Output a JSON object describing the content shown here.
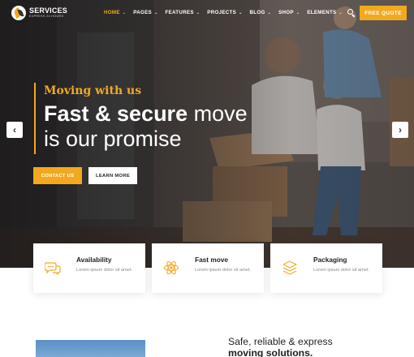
{
  "brand": {
    "name": "SERVICES",
    "tagline": "EXPRESS 24 HOURS",
    "accent": "#f2a91f"
  },
  "nav": {
    "items": [
      {
        "label": "HOME",
        "active": true
      },
      {
        "label": "PAGES",
        "active": false
      },
      {
        "label": "FEATURES",
        "active": false
      },
      {
        "label": "PROJECTS",
        "active": false
      },
      {
        "label": "BLOG",
        "active": false
      },
      {
        "label": "SHOP",
        "active": false
      },
      {
        "label": "ELEMENTS",
        "active": false
      }
    ],
    "chevron": "⌄",
    "search_icon": "search-icon",
    "quote_label": "FREE QUOTE"
  },
  "hero": {
    "kicker": "Moving with us",
    "title_bold": "Fast & secure",
    "title_rest": "move",
    "title_line2": "is our promise",
    "contact_label": "CONTACT US",
    "learn_label": "LEARN MORE",
    "prev_glyph": "‹",
    "next_glyph": "›"
  },
  "features": [
    {
      "icon": "chat-bubbles-icon",
      "title": "Availability",
      "desc": "Lorem ipsum dolor sit amet."
    },
    {
      "icon": "atom-icon",
      "title": "Fast move",
      "desc": "Lorem ipsum dolor sit amet."
    },
    {
      "icon": "layers-icon",
      "title": "Packaging",
      "desc": "Lorem ipsum dolor sit amet."
    }
  ],
  "about": {
    "title_line1": "Safe, reliable & express",
    "title_line2": "moving solutions."
  }
}
